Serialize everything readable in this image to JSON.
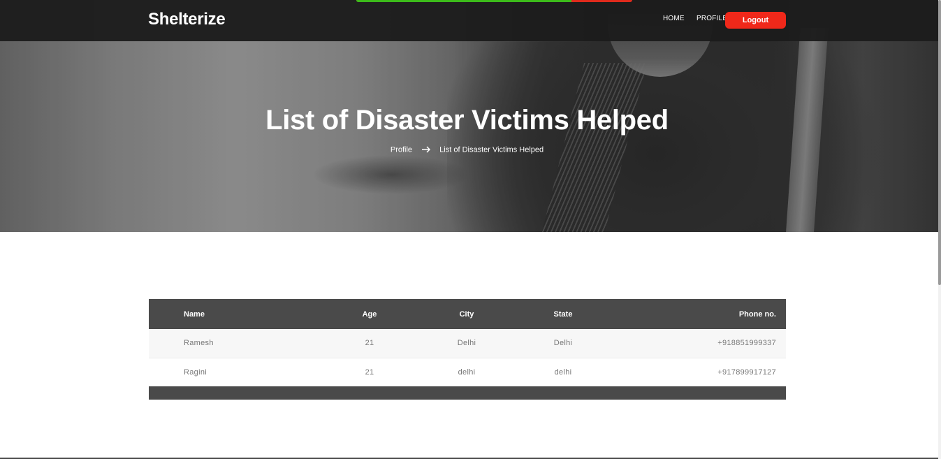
{
  "brand": "Shelterize",
  "nav": {
    "home": "HOME",
    "profile": "PROFILE",
    "logout": "Logout"
  },
  "progress": {
    "fraction_complete": 0.78,
    "fill_color": "#3cbb1a",
    "remaining_color": "#e02a1c"
  },
  "hero": {
    "title": "List of Disaster Victims Helped",
    "breadcrumb": {
      "parent": "Profile",
      "separator_icon": "arrow-right-icon",
      "current": "List of Disaster Victims Helped"
    }
  },
  "table": {
    "columns": [
      "Name",
      "Age",
      "City",
      "State",
      "Phone no."
    ],
    "rows": [
      {
        "name": "Ramesh",
        "age": "21",
        "city": "Delhi",
        "state": "Delhi",
        "phone": "+918851999337"
      },
      {
        "name": "Ragini",
        "age": "21",
        "city": "delhi",
        "state": "delhi",
        "phone": "+917899917127"
      }
    ]
  },
  "colors": {
    "topbar": "#1c1c1c",
    "accent_button": "#f0281a",
    "table_header": "#4a4a4a"
  }
}
